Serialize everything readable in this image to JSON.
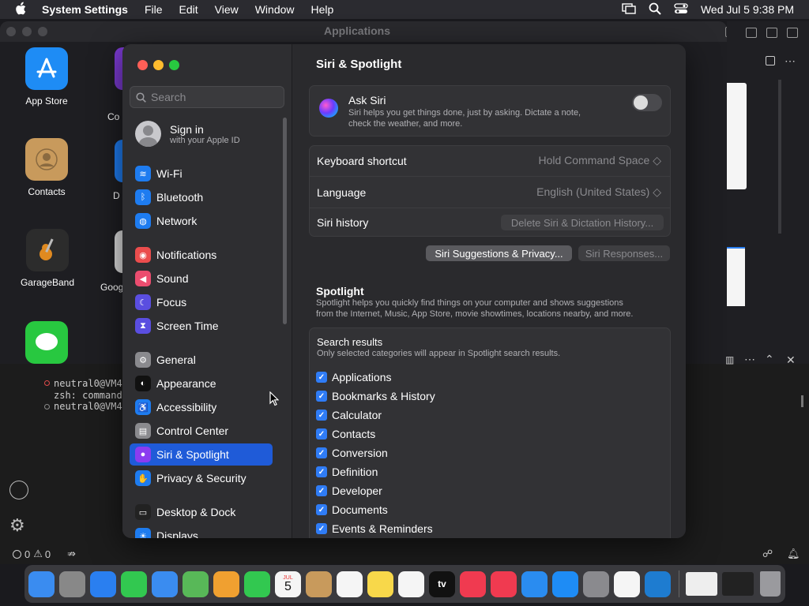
{
  "menubar": {
    "app_name": "System Settings",
    "menus": [
      "File",
      "Edit",
      "View",
      "Window",
      "Help"
    ],
    "datetime": "Wed Jul 5  9:38 PM"
  },
  "finder": {
    "title": "Applications",
    "apps": [
      {
        "label": "App Store",
        "color": "#1e8cf5"
      },
      {
        "label": "Contacts",
        "color": "#c89a5c"
      },
      {
        "label": "GarageBand",
        "color": "#333"
      },
      {
        "label": "",
        "color": "#28c840"
      }
    ],
    "partial_labels": [
      "Co",
      "D",
      "Goog"
    ]
  },
  "terminal": {
    "lines": [
      "neutral0@VM4",
      "zsh: command",
      "neutral0@VM4"
    ]
  },
  "statusbar": {
    "errors": "0",
    "warnings": "0"
  },
  "settings": {
    "search_placeholder": "Search",
    "signin": {
      "title": "Sign in",
      "subtitle": "with your Apple ID"
    },
    "sidebar": [
      {
        "label": "Wi-Fi",
        "color": "#1e7cf0",
        "icon": "wifi-icon",
        "glyph": "≋"
      },
      {
        "label": "Bluetooth",
        "color": "#1e7cf0",
        "icon": "bluetooth-icon",
        "glyph": "ᛒ"
      },
      {
        "label": "Network",
        "color": "#1e7cf0",
        "icon": "globe-icon",
        "glyph": "◍"
      },
      {
        "label": "Notifications",
        "color": "#eb4d4d",
        "icon": "bell-icon",
        "glyph": "◉"
      },
      {
        "label": "Sound",
        "color": "#eb4d6f",
        "icon": "speaker-icon",
        "glyph": "◀"
      },
      {
        "label": "Focus",
        "color": "#5a4ee0",
        "icon": "moon-icon",
        "glyph": "☾"
      },
      {
        "label": "Screen Time",
        "color": "#5a4ee0",
        "icon": "hourglass-icon",
        "glyph": "⧗"
      },
      {
        "label": "General",
        "color": "#8a8a8e",
        "icon": "gear-icon",
        "glyph": "⚙"
      },
      {
        "label": "Appearance",
        "color": "#111",
        "icon": "appearance-icon",
        "glyph": "◐"
      },
      {
        "label": "Accessibility",
        "color": "#1e7cf0",
        "icon": "accessibility-icon",
        "glyph": "♿"
      },
      {
        "label": "Control Center",
        "color": "#8a8a8e",
        "icon": "control-center-icon",
        "glyph": "▤"
      },
      {
        "label": "Siri & Spotlight",
        "color": "#8b3cf0",
        "icon": "siri-icon",
        "glyph": "●"
      },
      {
        "label": "Privacy & Security",
        "color": "#1e7cf0",
        "icon": "hand-icon",
        "glyph": "✋"
      },
      {
        "label": "Desktop & Dock",
        "color": "#222",
        "icon": "dock-icon",
        "glyph": "▭"
      },
      {
        "label": "Displays",
        "color": "#1e7cf0",
        "icon": "display-icon",
        "glyph": "☀"
      }
    ],
    "content": {
      "title": "Siri & Spotlight",
      "ask_siri": {
        "title": "Ask Siri",
        "desc1": "Siri helps you get things done, just by asking. Dictate a note,",
        "desc2": "check the weather, and more."
      },
      "keyboard_shortcut": {
        "label": "Keyboard shortcut",
        "value": "Hold Command Space ◇"
      },
      "language": {
        "label": "Language",
        "value": "English (United States) ◇"
      },
      "siri_history": {
        "label": "Siri history",
        "button": "Delete Siri & Dictation History..."
      },
      "suggestions_button": "Siri Suggestions & Privacy...",
      "responses_button": "Siri Responses...",
      "spotlight": {
        "title": "Spotlight",
        "desc1": "Spotlight helps you quickly find things on your computer and shows suggestions",
        "desc2": "from the Internet, Music, App Store, movie showtimes, locations nearby, and more."
      },
      "search_results": {
        "title": "Search results",
        "subtitle": "Only selected categories will appear in Spotlight search results.",
        "items": [
          "Applications",
          "Bookmarks & History",
          "Calculator",
          "Contacts",
          "Conversion",
          "Definition",
          "Developer",
          "Documents",
          "Events & Reminders"
        ]
      }
    }
  },
  "dock": {
    "apps": [
      {
        "name": "finder-icon",
        "color": "#3a8cf0"
      },
      {
        "name": "launchpad-icon",
        "color": "#888"
      },
      {
        "name": "safari-icon",
        "color": "#2a7ff0"
      },
      {
        "name": "messages-icon",
        "color": "#32c850"
      },
      {
        "name": "mail-icon",
        "color": "#3a8cf0"
      },
      {
        "name": "maps-icon",
        "color": "#58b858"
      },
      {
        "name": "photos-icon",
        "color": "#f0a030"
      },
      {
        "name": "facetime-icon",
        "color": "#32c850"
      },
      {
        "name": "calendar-icon",
        "color": "#f5f5f5"
      },
      {
        "name": "contacts-icon",
        "color": "#c89a5c"
      },
      {
        "name": "reminders-icon",
        "color": "#f5f5f5"
      },
      {
        "name": "notes-icon",
        "color": "#f8d84a"
      },
      {
        "name": "freeform-icon",
        "color": "#f5f5f5"
      },
      {
        "name": "tv-icon",
        "color": "#111"
      },
      {
        "name": "music-icon",
        "color": "#f03a50"
      },
      {
        "name": "news-icon",
        "color": "#f03a50"
      },
      {
        "name": "keynote-icon",
        "color": "#2a8cf0"
      },
      {
        "name": "app-store-icon",
        "color": "#1e8cf5"
      },
      {
        "name": "system-settings-icon",
        "color": "#8a8a8e"
      },
      {
        "name": "chrome-icon",
        "color": "#f5f5f5"
      },
      {
        "name": "vscode-icon",
        "color": "#1e7cd0"
      }
    ],
    "calendar_month": "JUL",
    "calendar_day": "5",
    "tv_label": "tv"
  }
}
